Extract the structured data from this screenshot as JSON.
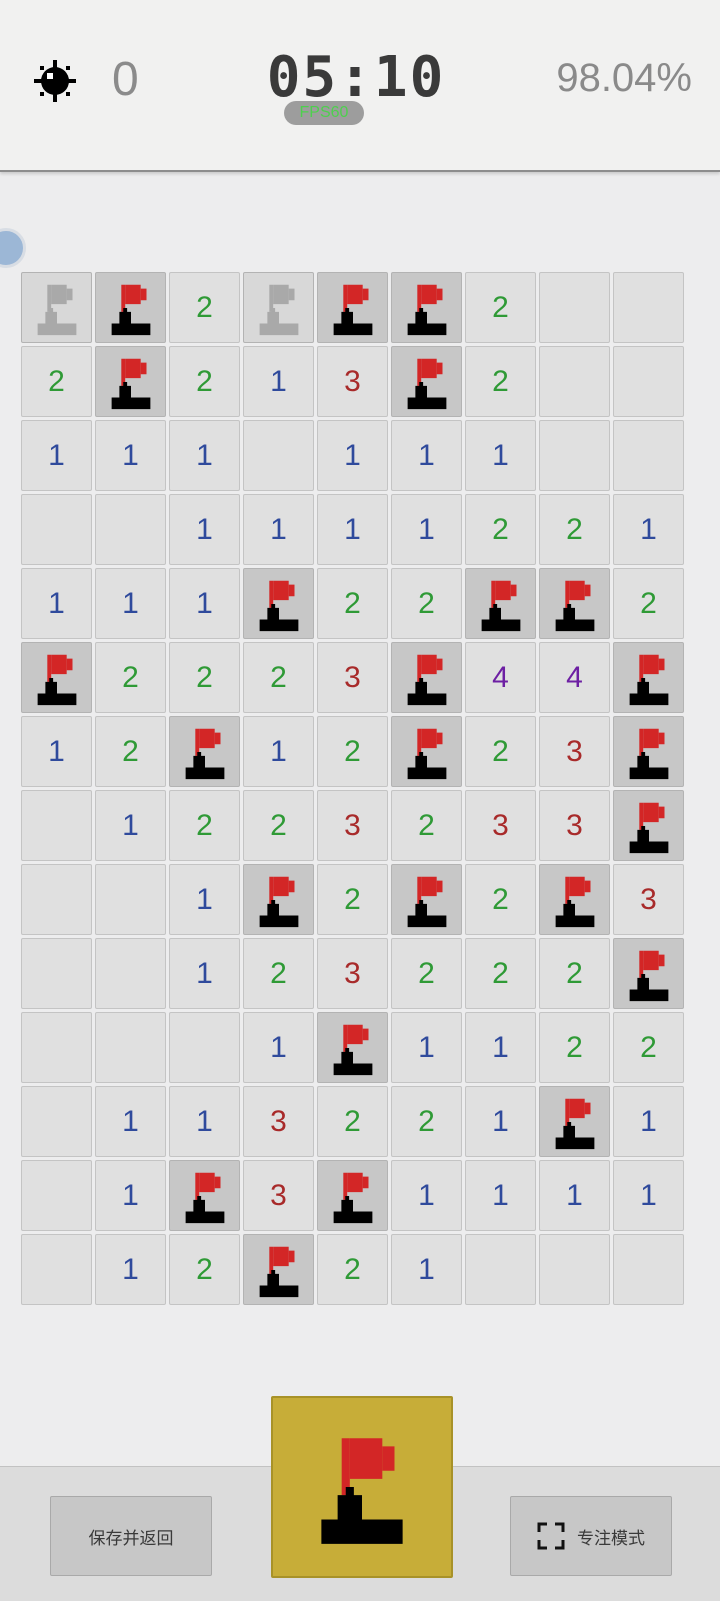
{
  "header": {
    "mines_flagged": "0",
    "timer": "05:10",
    "fps": "FPS60",
    "progress": "98.04%"
  },
  "board": {
    "rows": 14,
    "cols": 9,
    "cells": [
      [
        "f-gray",
        "f",
        "2",
        "f-gray",
        "f",
        "f",
        "2",
        "",
        ""
      ],
      [
        "2",
        "f",
        "2",
        "1",
        "3",
        "f",
        "2",
        "",
        ""
      ],
      [
        "1",
        "1",
        "1",
        "",
        "1",
        "1",
        "1",
        "",
        ""
      ],
      [
        "",
        "",
        "1",
        "1",
        "1",
        "1",
        "2",
        "2",
        "1"
      ],
      [
        "1",
        "1",
        "1",
        "f",
        "2",
        "2",
        "f",
        "f",
        "2"
      ],
      [
        "f",
        "2",
        "2",
        "2",
        "3",
        "f",
        "4",
        "4",
        "f"
      ],
      [
        "1",
        "2",
        "f",
        "1",
        "2",
        "f",
        "2",
        "3",
        "f"
      ],
      [
        "",
        "1",
        "2",
        "2",
        "3",
        "2",
        "3",
        "3",
        "f"
      ],
      [
        "",
        "",
        "1",
        "f",
        "2",
        "f",
        "2",
        "f",
        "3"
      ],
      [
        "",
        "",
        "1",
        "2",
        "3",
        "2",
        "2",
        "2",
        "f"
      ],
      [
        "",
        "",
        "",
        "1",
        "f",
        "1",
        "1",
        "2",
        "2"
      ],
      [
        "",
        "1",
        "1",
        "3",
        "2",
        "2",
        "1",
        "f",
        "1"
      ],
      [
        "",
        "1",
        "f",
        "3",
        "f",
        "1",
        "1",
        "1",
        "1"
      ],
      [
        "",
        "1",
        "2",
        "f",
        "2",
        "1",
        "",
        "",
        ""
      ]
    ]
  },
  "colors": {
    "n1": "#2f4a9c",
    "n2": "#2f9a36",
    "n3": "#a82a2a",
    "n4": "#6d1fa3",
    "flag_red": "#d32626",
    "accent_yellow": "#c7ad38"
  },
  "footer": {
    "save_label": "保存并返回",
    "focus_label": "专注模式",
    "focus_icon": "fullscreen-icon",
    "toggle_icon": "flag-icon"
  }
}
